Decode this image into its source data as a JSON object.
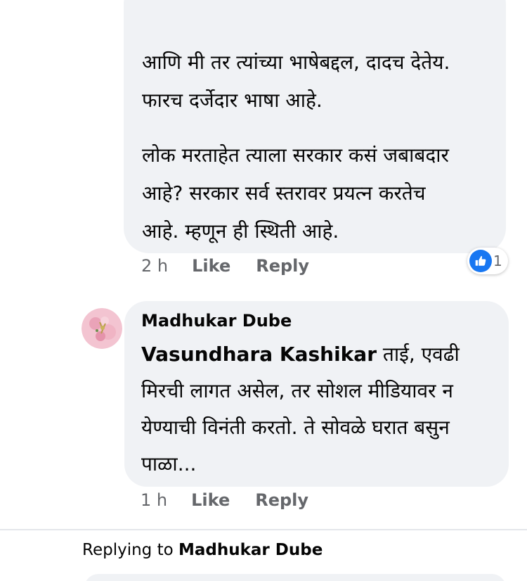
{
  "comment1": {
    "paragraphs": [
      [
        "आणि मी तर त्यांच्या भाषेबद्दल, दादच देतेय.",
        "फारच दर्जेदार भाषा आहे."
      ],
      [
        "लोक मरताहेत त्याला सरकार कसं जबाबदार",
        "आहे? सरकार सर्व स्तरावर प्रयत्न करतेच",
        "आहे. म्हणून ही स्थिती आहे."
      ]
    ],
    "time": "2 h",
    "like_label": "Like",
    "reply_label": "Reply",
    "reaction_count": "1"
  },
  "comment2": {
    "author": "Madhukar Dube",
    "mention": "Vasundhara Kashikar",
    "text_after_mention": " ताई, एवढी",
    "lines": [
      "मिरची लागत असेल, तर सोशल मीडियावर न",
      "येण्याची विनंती करतो. ते सोवळे घरात बसुन",
      "पाळा..."
    ],
    "time": "1 h",
    "like_label": "Like",
    "reply_label": "Reply"
  },
  "replying": {
    "prefix": "Replying to ",
    "name": "Madhukar Dube"
  },
  "colors": {
    "bubble": "#f0f2f5",
    "meta_text": "#65676b",
    "like_blue": "#1877f2"
  },
  "icons": {
    "reaction": "like-thumb-icon",
    "avatar": "profile-avatar"
  }
}
